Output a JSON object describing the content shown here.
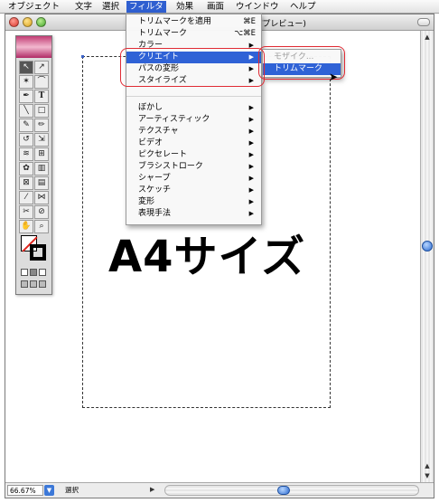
{
  "menubar": {
    "items": [
      "オブジェクト",
      "文字",
      "選択",
      "フィルタ",
      "効果",
      "画面",
      "ウインドウ",
      "ヘルプ"
    ],
    "active": "フィルタ"
  },
  "window": {
    "title_visible": "YK/プレビュー)"
  },
  "canvas": {
    "big_text": "A4サイズ"
  },
  "filter_menu": {
    "top_items": [
      {
        "label": "トリムマークを適用",
        "shortcut": "⌘E"
      },
      {
        "label": "トリムマーク",
        "shortcut": "⌥⌘E"
      }
    ],
    "group1": [
      "カラー",
      "クリエイト",
      "パスの変形",
      "スタイライズ"
    ],
    "highlighted": "クリエイト",
    "group2": [
      "ぼかし",
      "アーティスティック",
      "テクスチャ",
      "ビデオ",
      "ピクセレート",
      "ブラシストローク",
      "シャープ",
      "スケッチ",
      "変形",
      "表現手法"
    ]
  },
  "create_submenu": {
    "items": [
      "モザイク...",
      "トリムマーク"
    ],
    "disabled": "モザイク...",
    "highlighted": "トリムマーク"
  },
  "statusbar": {
    "zoom": "66.67%",
    "status_text": "選択"
  },
  "colors": {
    "menu_highlight": "#2f62d6",
    "callout": "#e02b34",
    "scroll_thumb": "#2b6ad0"
  },
  "icons": {
    "palette_tools": [
      "selection-arrow",
      "direct-select-arrow",
      "magic-wand",
      "lasso",
      "pen",
      "type",
      "line",
      "rectangle",
      "paintbrush",
      "pencil",
      "rotate",
      "scale",
      "warp",
      "free-transform",
      "symbol-sprayer",
      "graph",
      "mesh",
      "gradient",
      "eyedropper",
      "blend",
      "scissors",
      "knife",
      "hand",
      "zoom"
    ]
  }
}
